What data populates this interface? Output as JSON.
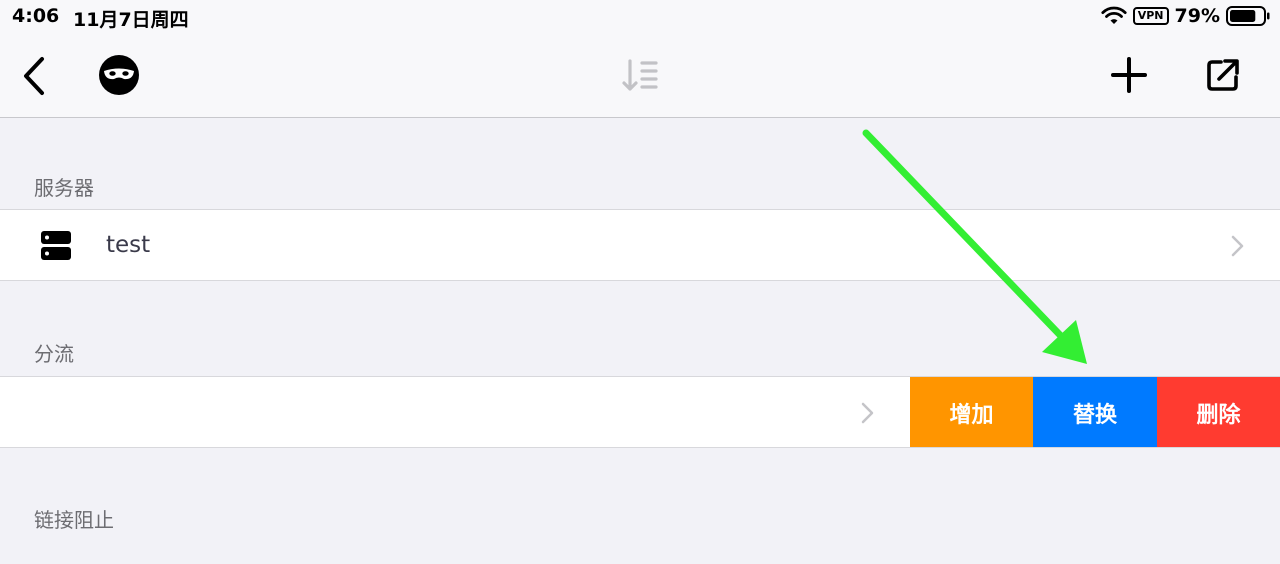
{
  "status_bar": {
    "time": "4:06",
    "date": "11月7日周四",
    "vpn": "VPN",
    "battery": "79%",
    "battery_level": 0.79
  },
  "nav": {
    "icons": [
      "chevron-left-icon",
      "mask-icon",
      "sort-icon",
      "plus-icon",
      "share-icon"
    ]
  },
  "sections": {
    "server": {
      "header": "服务器",
      "item": {
        "name": "test",
        "icon": "server-icon"
      }
    },
    "rule": {
      "header": "分流",
      "actions": {
        "add": "增加",
        "replace": "替换",
        "delete": "删除"
      }
    },
    "block": {
      "header": "链接阻止"
    }
  },
  "colors": {
    "add": "#ff9500",
    "replace": "#007aff",
    "delete": "#ff3b30",
    "annotation_arrow": "#33ee33"
  }
}
